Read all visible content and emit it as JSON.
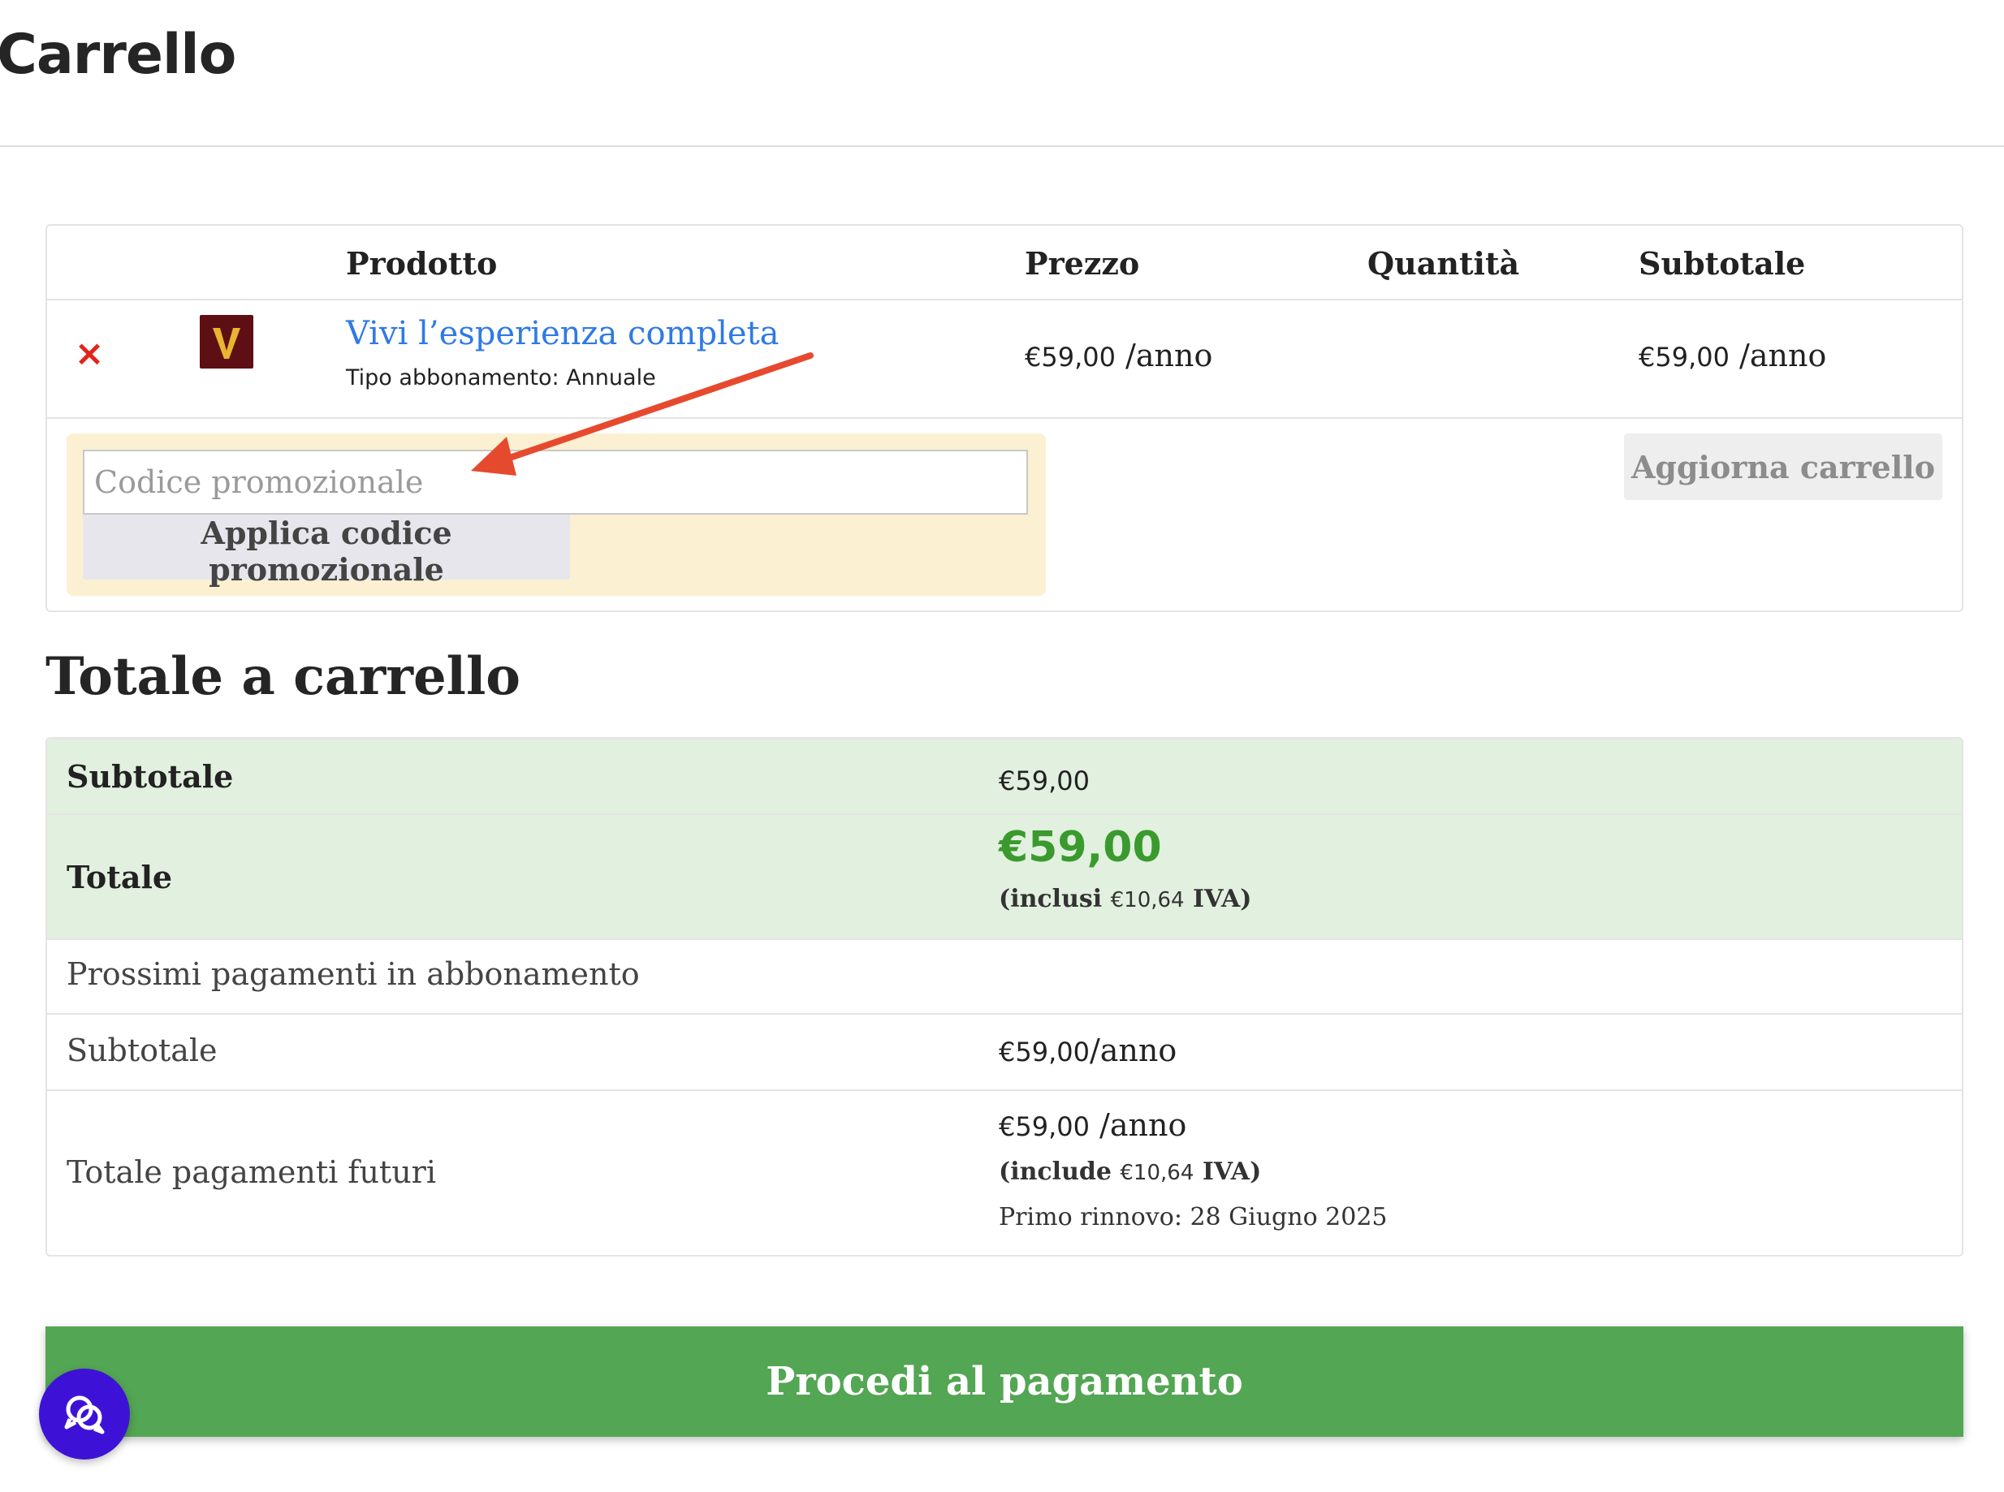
{
  "page": {
    "title": "Carrello"
  },
  "cart": {
    "headers": {
      "product": "Prodotto",
      "price": "Prezzo",
      "quantity": "Quantità",
      "subtotal": "Subtotale"
    },
    "item": {
      "name": "Vivi l’esperienza completa",
      "meta": "Tipo abbonamento: Annuale",
      "price_amount": "€59,00",
      "price_period": " /anno",
      "subtotal_amount": "€59,00",
      "subtotal_period": " /anno",
      "thumb_letter": "V",
      "thumb_color": "#5e0f14"
    },
    "promo": {
      "placeholder": "Codice promozionale",
      "value": "",
      "apply_label": "Applica codice promozionale"
    },
    "update_label": "Aggiorna carrello"
  },
  "totals": {
    "title": "Totale a carrello",
    "subtotal": {
      "label": "Subtotale",
      "amount": "€59,00"
    },
    "total": {
      "label": "Totale",
      "amount": "€59,00",
      "tax_prefix": "(inclusi ",
      "tax_amount": "€10,64",
      "tax_suffix": " IVA)"
    },
    "recurring": {
      "heading": "Prossimi pagamenti in abbonamento",
      "subtotal": {
        "label": "Subtotale",
        "amount": "€59,00",
        "period": "/anno"
      },
      "future": {
        "label": "Totale pagamenti futuri",
        "amount": "€59,00",
        "period": " /anno",
        "tax_prefix": "(include ",
        "tax_amount": "€10,64",
        "tax_suffix": " IVA)",
        "renewal": "Primo rinnovo: 28 Giugno 2025"
      }
    }
  },
  "checkout": {
    "label": "Procedi al pagamento"
  },
  "colors": {
    "accent_green": "#53a653",
    "total_green": "#3a9a2e",
    "link_blue": "#2f7ae5",
    "remove_red": "#e2241b",
    "chat_purple": "#3e12d6",
    "arrow_red": "#e64a2e"
  }
}
